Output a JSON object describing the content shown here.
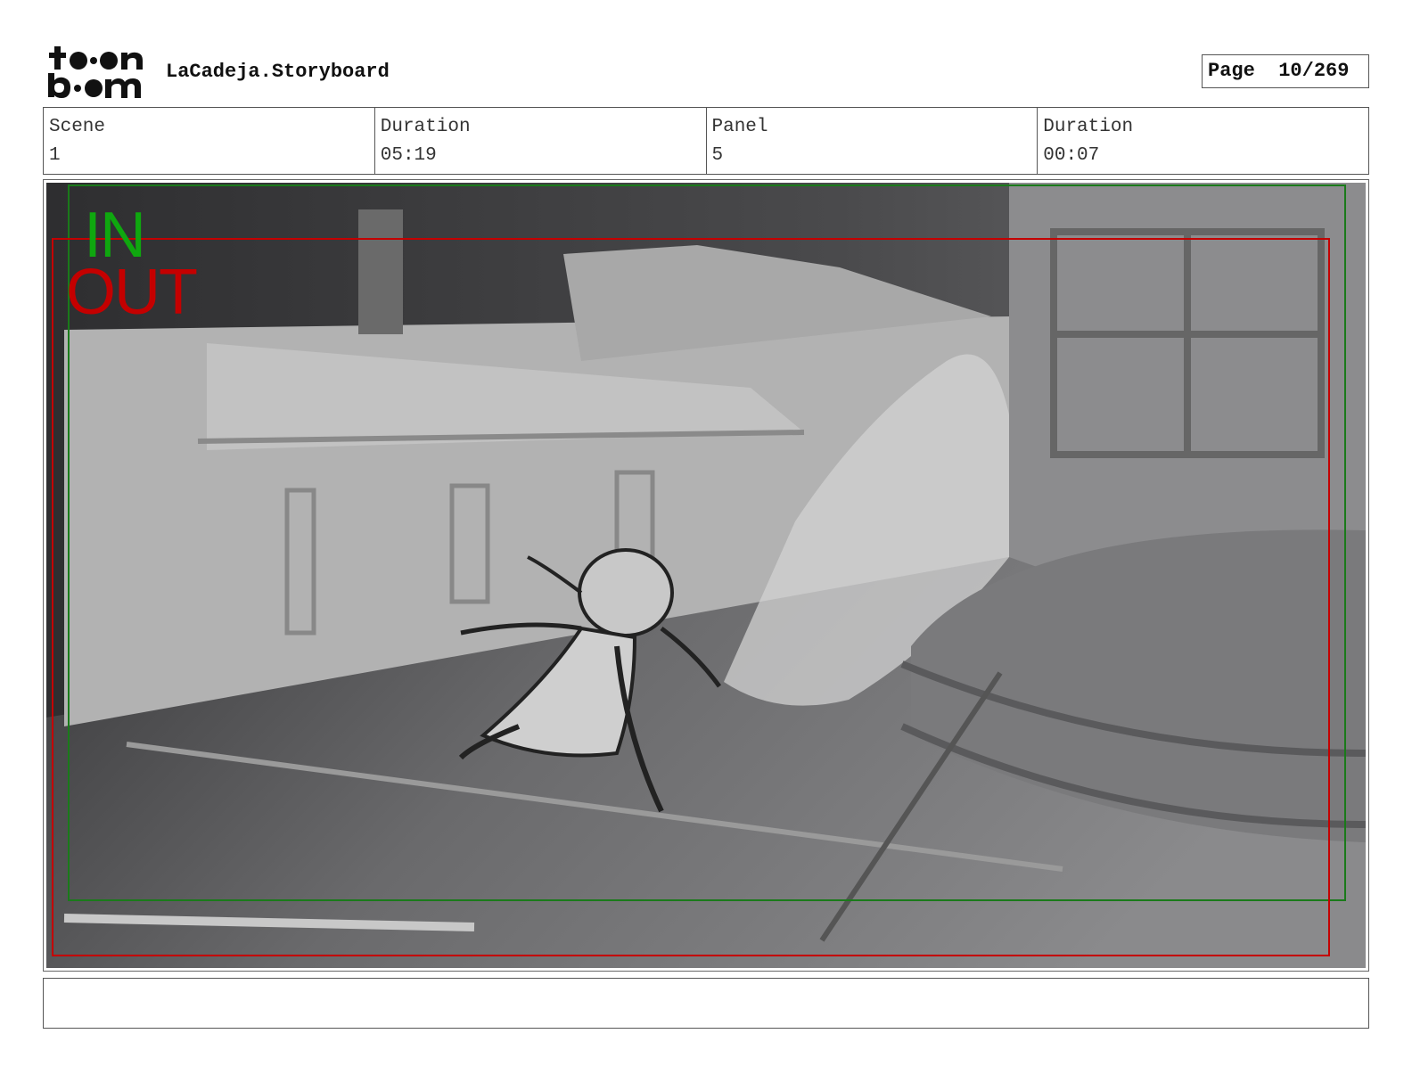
{
  "header": {
    "logo_text": "toon boom",
    "project_title": "LaCadeja.Storyboard",
    "page_label": "Page",
    "page_number": "10/269"
  },
  "info": {
    "scene_label": "Scene",
    "scene_value": "1",
    "scene_duration_label": "Duration",
    "scene_duration_value": "05:19",
    "panel_label": "Panel",
    "panel_value": "5",
    "panel_duration_label": "Duration",
    "panel_duration_value": "00:07"
  },
  "panel": {
    "in_label": "IN",
    "out_label": "OUT",
    "in_frame_color": "#1a7a1a",
    "out_frame_color": "#c40000"
  },
  "notes": {
    "text": ""
  }
}
